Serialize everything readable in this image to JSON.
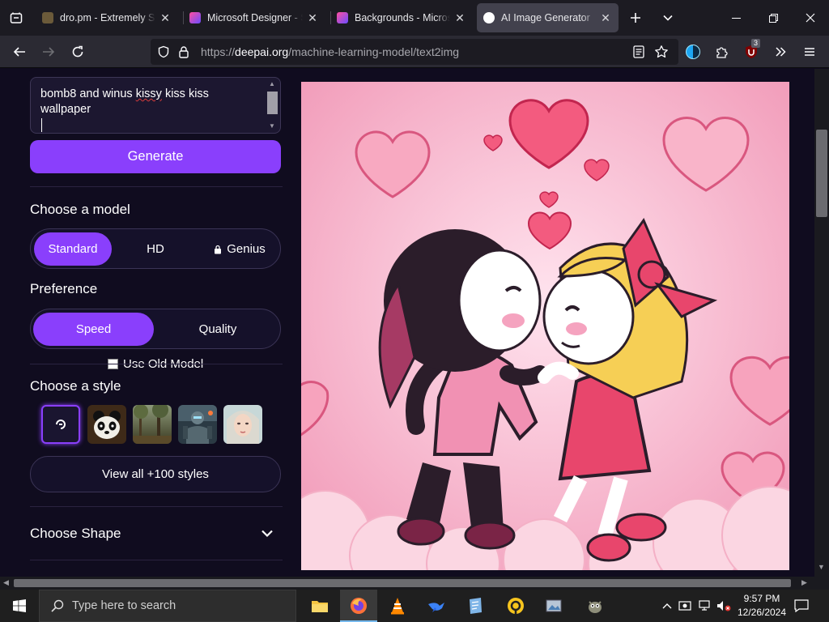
{
  "browser": {
    "tabs": [
      {
        "title": "dro.pm - Extremely Sh",
        "active": false
      },
      {
        "title": "Microsoft Designer - St",
        "active": false
      },
      {
        "title": "Backgrounds - Microso",
        "active": false
      },
      {
        "title": "AI Image Generator",
        "active": true
      }
    ],
    "tab_close_glyph": "✕",
    "url_prefix": "https://",
    "url_host": "deepai.org",
    "url_path": "/machine-learning-model/text2img",
    "extension_badge": "3"
  },
  "page": {
    "prompt": {
      "before": "bomb8 and winus ",
      "misspelled": "kissy",
      "after": " kiss kiss wallpaper"
    },
    "generate_label": "Generate",
    "model": {
      "label": "Choose a model",
      "options": [
        "Standard",
        "HD",
        "Genius"
      ],
      "selected": "Standard"
    },
    "preference": {
      "label": "Preference",
      "options": [
        "Speed",
        "Quality"
      ],
      "selected": "Speed"
    },
    "old_model_label": "Use Old Model",
    "style": {
      "label": "Choose a style",
      "thumbs": [
        "default-style-icon",
        "panda",
        "forest",
        "armored-soldier",
        "portrait"
      ],
      "view_all_label": "View all +100 styles"
    },
    "shape_label": "Choose Shape",
    "accent_color": "#8a3ffc"
  },
  "taskbar": {
    "search_placeholder": "Type here to search",
    "time": "9:57 PM",
    "date": "12/26/2024",
    "apps": [
      "file-explorer",
      "firefox",
      "vlc",
      "eagle-app",
      "notepad-app",
      "camtasia",
      "photos-app",
      "gimp"
    ]
  }
}
